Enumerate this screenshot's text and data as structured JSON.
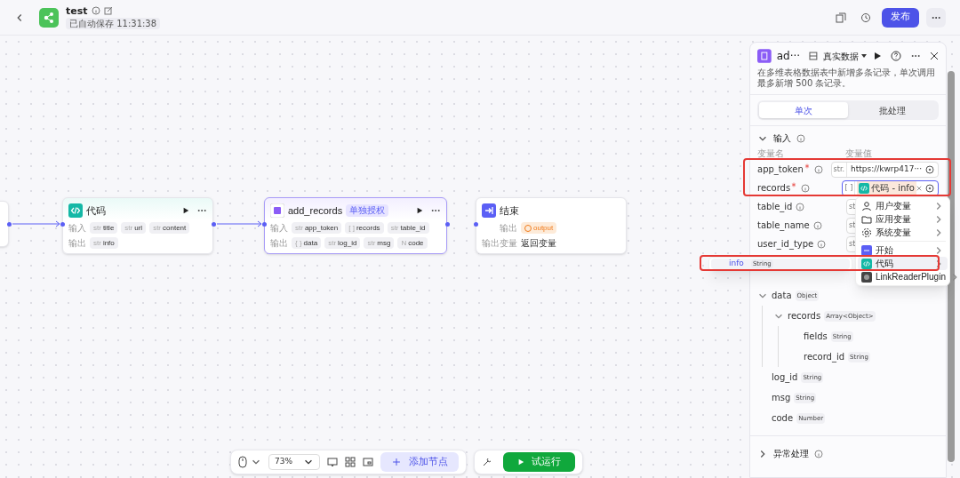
{
  "header": {
    "title": "test",
    "saved": "已自动保存 11:31:38",
    "publish": "发布"
  },
  "canvas": {
    "nodes": [
      {
        "kind": "partial"
      },
      {
        "kind": "code",
        "title": "代码",
        "rows": [
          {
            "label": "输入",
            "tags": [
              {
                "type": "str",
                "name": "title"
              },
              {
                "type": "str",
                "name": "url"
              },
              {
                "type": "str",
                "name": "content"
              }
            ]
          },
          {
            "label": "输出",
            "tags": [
              {
                "type": "str",
                "name": "info"
              }
            ]
          }
        ]
      },
      {
        "kind": "plugin",
        "title": "add_records",
        "badge": "单独授权",
        "selected": true,
        "rows": [
          {
            "label": "输入",
            "tags": [
              {
                "type": "str",
                "name": "app_token"
              },
              {
                "type": "[ ]",
                "name": "records"
              },
              {
                "type": "str",
                "name": "table_id"
              }
            ]
          },
          {
            "label": "输出",
            "tags": [
              {
                "type": "{ }",
                "name": "data"
              },
              {
                "type": "str",
                "name": "log_id"
              },
              {
                "type": "str",
                "name": "msg"
              },
              {
                "type": "N",
                "name": "code"
              }
            ]
          }
        ]
      },
      {
        "kind": "end",
        "title": "结束",
        "rows": [
          {
            "label": "输出",
            "tags": [
              {
                "kind": "warning",
                "name": "output"
              }
            ]
          },
          {
            "label": "输出变量",
            "text": "返回变量"
          }
        ]
      }
    ]
  },
  "toolbar": {
    "zoom": "73%",
    "add": "添加节点",
    "run": "试运行"
  },
  "panel": {
    "title": "ad···",
    "mode": "真实数据",
    "description": "在多维表格数据表中新增多条记录，单次调用最多新增 500 条记录。",
    "tabs": [
      {
        "label": "单次",
        "selected": true
      },
      {
        "label": "批处理",
        "selected": false
      }
    ],
    "input": {
      "title": "输入",
      "expanded": true,
      "col_name": "变量名",
      "col_value": "变量值",
      "params": [
        {
          "name": "app_token",
          "required": true,
          "type": "str.",
          "value": "https://kwrp417···"
        },
        {
          "name": "records",
          "required": true,
          "type": "[ ]",
          "chip": "代码 - info"
        },
        {
          "name": "table_id",
          "required": false,
          "type": "st"
        },
        {
          "name": "table_name",
          "required": false,
          "type": "st"
        },
        {
          "name": "user_id_type",
          "required": false,
          "type": "st"
        }
      ]
    },
    "output_tree": [
      {
        "name": "data",
        "type": "Object",
        "expanded": true,
        "children": [
          {
            "name": "records",
            "type": "Array<Object>",
            "expanded": true,
            "children": [
              {
                "name": "fields",
                "type": "String"
              },
              {
                "name": "record_id",
                "type": "String"
              }
            ]
          }
        ]
      },
      {
        "name": "log_id",
        "type": "String"
      },
      {
        "name": "msg",
        "type": "String"
      },
      {
        "name": "code",
        "type": "Number"
      }
    ],
    "error": {
      "title": "异常处理",
      "expanded": false
    }
  },
  "menu": {
    "items": [
      {
        "kind": "user",
        "label": "用户变量",
        "selected": false
      },
      {
        "kind": "app",
        "label": "应用变量",
        "selected": false
      },
      {
        "kind": "system",
        "label": "系统变量",
        "selected": false
      },
      {
        "kind": "start",
        "label": "开始",
        "selected": false
      },
      {
        "kind": "code",
        "label": "代码",
        "selected": true
      },
      {
        "kind": "plugin",
        "label": "LinkReaderPlugin",
        "selected": false
      }
    ],
    "submenu": [
      {
        "name": "info",
        "type": "String"
      }
    ]
  }
}
